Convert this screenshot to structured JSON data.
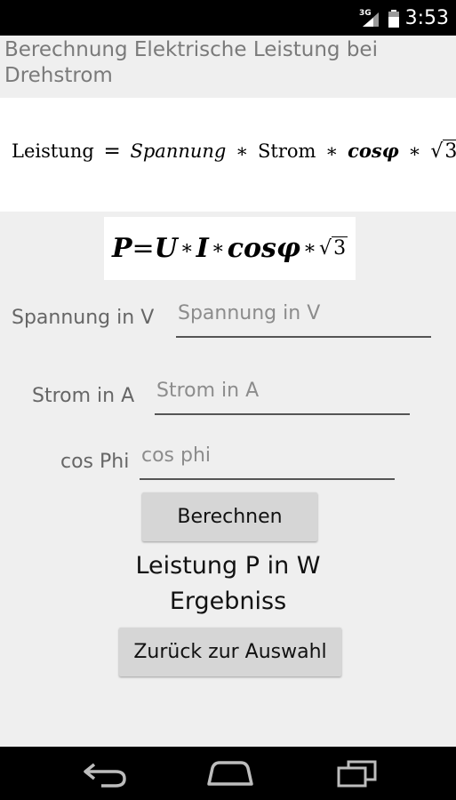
{
  "status_bar": {
    "network": "3G",
    "time": "3:53"
  },
  "title": "Berechnung Elektrische Leistung bei Drehstrom",
  "formula_words": {
    "leistung": "Leistung",
    "equals": "=",
    "spannung": "Spannung",
    "times": "∗",
    "strom": "Strom",
    "cosphi": "cosφ",
    "radical": "√",
    "three": "3"
  },
  "formula_symbols": {
    "p": "P",
    "equals": "=",
    "u": "U",
    "times": "∗",
    "i": "I",
    "cosphi": "cosφ",
    "radical": "√",
    "three": "3"
  },
  "form": {
    "voltage": {
      "label": "Spannung in V",
      "placeholder": "Spannung in V",
      "value": ""
    },
    "current": {
      "label": "Strom in A",
      "placeholder": "Strom in A",
      "value": ""
    },
    "cosphi": {
      "label": "cos Phi",
      "placeholder": "cos phi",
      "value": ""
    }
  },
  "calculate_label": "Berechnen",
  "result": {
    "label": "Leistung P in W",
    "value": "Ergebniss"
  },
  "back_label": "Zurück zur Auswahl",
  "nav": {
    "back": "back-icon",
    "home": "home-icon",
    "recent": "recent-apps-icon"
  }
}
